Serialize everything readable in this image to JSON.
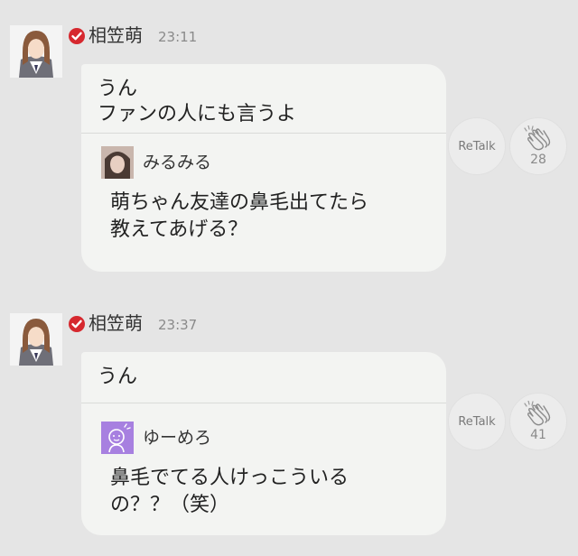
{
  "colors": {
    "background": "#e5e5e5",
    "bubble": "#f3f4f2",
    "verified_badge": "#d6282e",
    "quote_avatar_2": "#a780e0"
  },
  "posts": [
    {
      "author": "相笠萌",
      "time": "23:11",
      "message_lines": [
        "うん",
        "ファンの人にも言うよ"
      ],
      "quote": {
        "name": "みるみる",
        "text_lines": [
          "萌ちゃん友達の鼻毛出てたら",
          "教えてあげる？"
        ]
      },
      "retalk_label": "ReTalk",
      "clap_count": "28"
    },
    {
      "author": "相笠萌",
      "time": "23:37",
      "message_lines": [
        "うん"
      ],
      "quote": {
        "name": "ゆーめろ",
        "text_lines": [
          "鼻毛でてる人けっこういる",
          "の？？（笑）"
        ]
      },
      "retalk_label": "ReTalk",
      "clap_count": "41"
    }
  ]
}
